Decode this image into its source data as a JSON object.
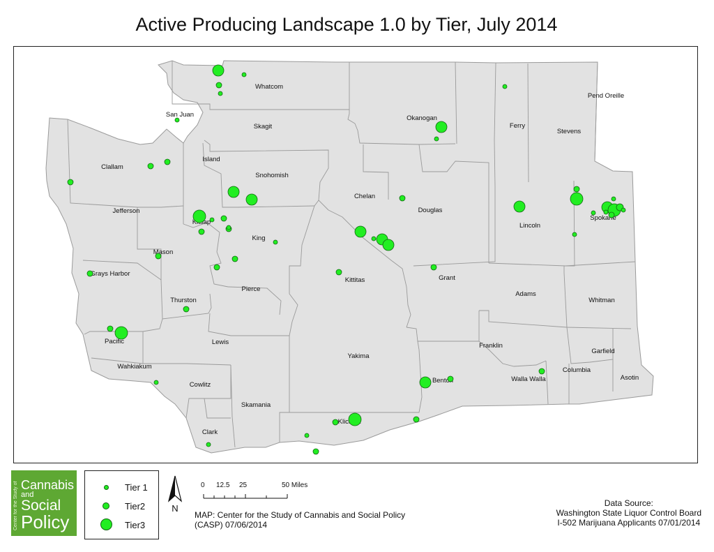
{
  "title": "Active Producing Landscape 1.0 by Tier, July 2014",
  "colors": {
    "land": "#e2e2e2",
    "county_border": "#9a9a9a",
    "dot_fill": "#22ee22",
    "dot_stroke": "#116611",
    "logo_green": "#5ea833"
  },
  "counties": [
    "Whatcom",
    "San Juan",
    "Skagit",
    "Okanogan",
    "Ferry",
    "Stevens",
    "Pend Oreille",
    "Clallam",
    "Island",
    "Snohomish",
    "Jefferson",
    "Kitsap",
    "Chelan",
    "Douglas",
    "Lincoln",
    "Spokane",
    "Mason",
    "King",
    "Grays Harbor",
    "Pierce",
    "Kittitas",
    "Grant",
    "Adams",
    "Whitman",
    "Thurston",
    "Pacific",
    "Lewis",
    "Franklin",
    "Yakima",
    "Garfield",
    "Wahkiakum",
    "Columbia",
    "Asotin",
    "Benton",
    "Walla Walla",
    "Cowlitz",
    "Skamania",
    "Klickitat",
    "Clark"
  ],
  "legend": {
    "items": [
      {
        "label": "Tier 1",
        "tier": 1
      },
      {
        "label": "Tier2",
        "tier": 2
      },
      {
        "label": "Tier3",
        "tier": 3
      }
    ]
  },
  "north_arrow": {
    "label": "N"
  },
  "scale_bar": {
    "ticks": [
      "0",
      "12.5",
      "25",
      "50 Miles"
    ]
  },
  "credit": {
    "line1": "MAP:  Center for the Study of Cannabis and Social Policy",
    "line2": "(CASP) 07/06/2014"
  },
  "source": {
    "line1": "Data Source:",
    "line2": "Washington State Liquor Control Board",
    "line3": "I-502 Marijuana Applicants 07/01/2014"
  },
  "logo": {
    "vertical_text": "Center for the Study of",
    "line1": "Cannabis",
    "line2": "and",
    "line3": "Social",
    "line4": "Policy"
  }
}
